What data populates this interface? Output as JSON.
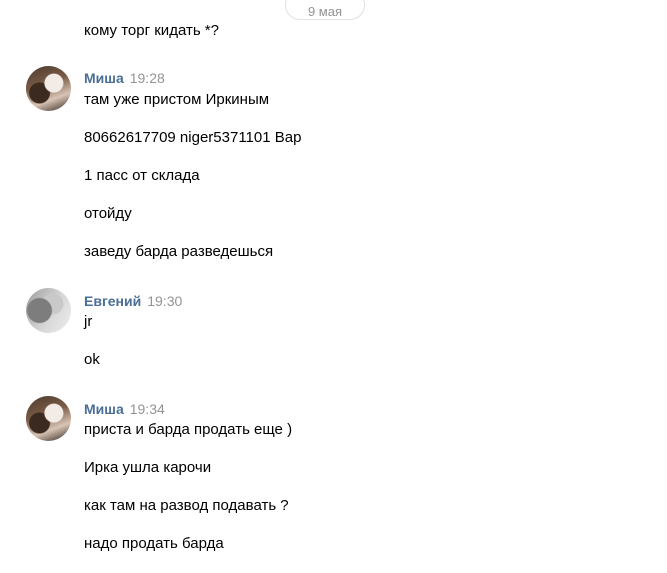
{
  "date_separator": "9 мая",
  "top_message": "кому торг кидать *?",
  "groups": [
    {
      "author": "Миша",
      "time": "19:28",
      "messages": [
        "там уже пристом Иркиным",
        "80662617709 niger5371101 Вар",
        "1 пасс от склада",
        "отойду",
        "заведу барда разведешься"
      ]
    },
    {
      "author": "Евгений",
      "time": "19:30",
      "messages": [
        "jr",
        "ok"
      ]
    },
    {
      "author": "Миша",
      "time": "19:34",
      "messages": [
        "приста и барда продать еще )",
        "Ирка ушла карочи",
        "как там на развод подавать ?",
        "надо продать барда"
      ]
    }
  ]
}
